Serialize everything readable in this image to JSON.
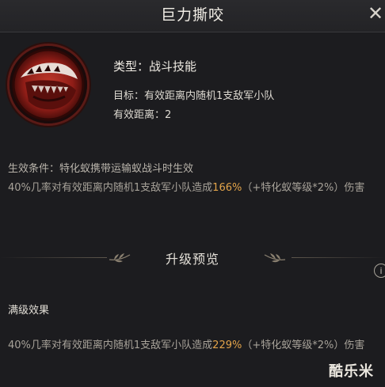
{
  "header": {
    "title": "巨力撕咬",
    "close_glyph": "✕"
  },
  "skill": {
    "icon": "biting-jaw-icon",
    "type_label": "类型：战斗技能",
    "target_label": "目标：有效距离内随机1支敌军小队",
    "range_label": "有效距离：2"
  },
  "condition": {
    "text": "生效条件：特化蚁携带运输蚁战斗时生效"
  },
  "effect": {
    "prefix": "40%几率对有效距离内随机1支敌军小队造成",
    "value": "166%",
    "suffix": "（+特化蚁等级*2%）伤害"
  },
  "upgrade_preview": {
    "title": "升级预览",
    "info_glyph": "i"
  },
  "max_level": {
    "label": "满级效果",
    "prefix": "40%几率对有效距离内随机1支敌军小队造成",
    "value": "229%",
    "suffix": "（+特化蚁等级*2%）伤害"
  },
  "watermark": "酷乐米",
  "colors": {
    "background": "#1c1c1f",
    "accent_gold": "#e3a44a",
    "icon_red": "#b3261e"
  }
}
